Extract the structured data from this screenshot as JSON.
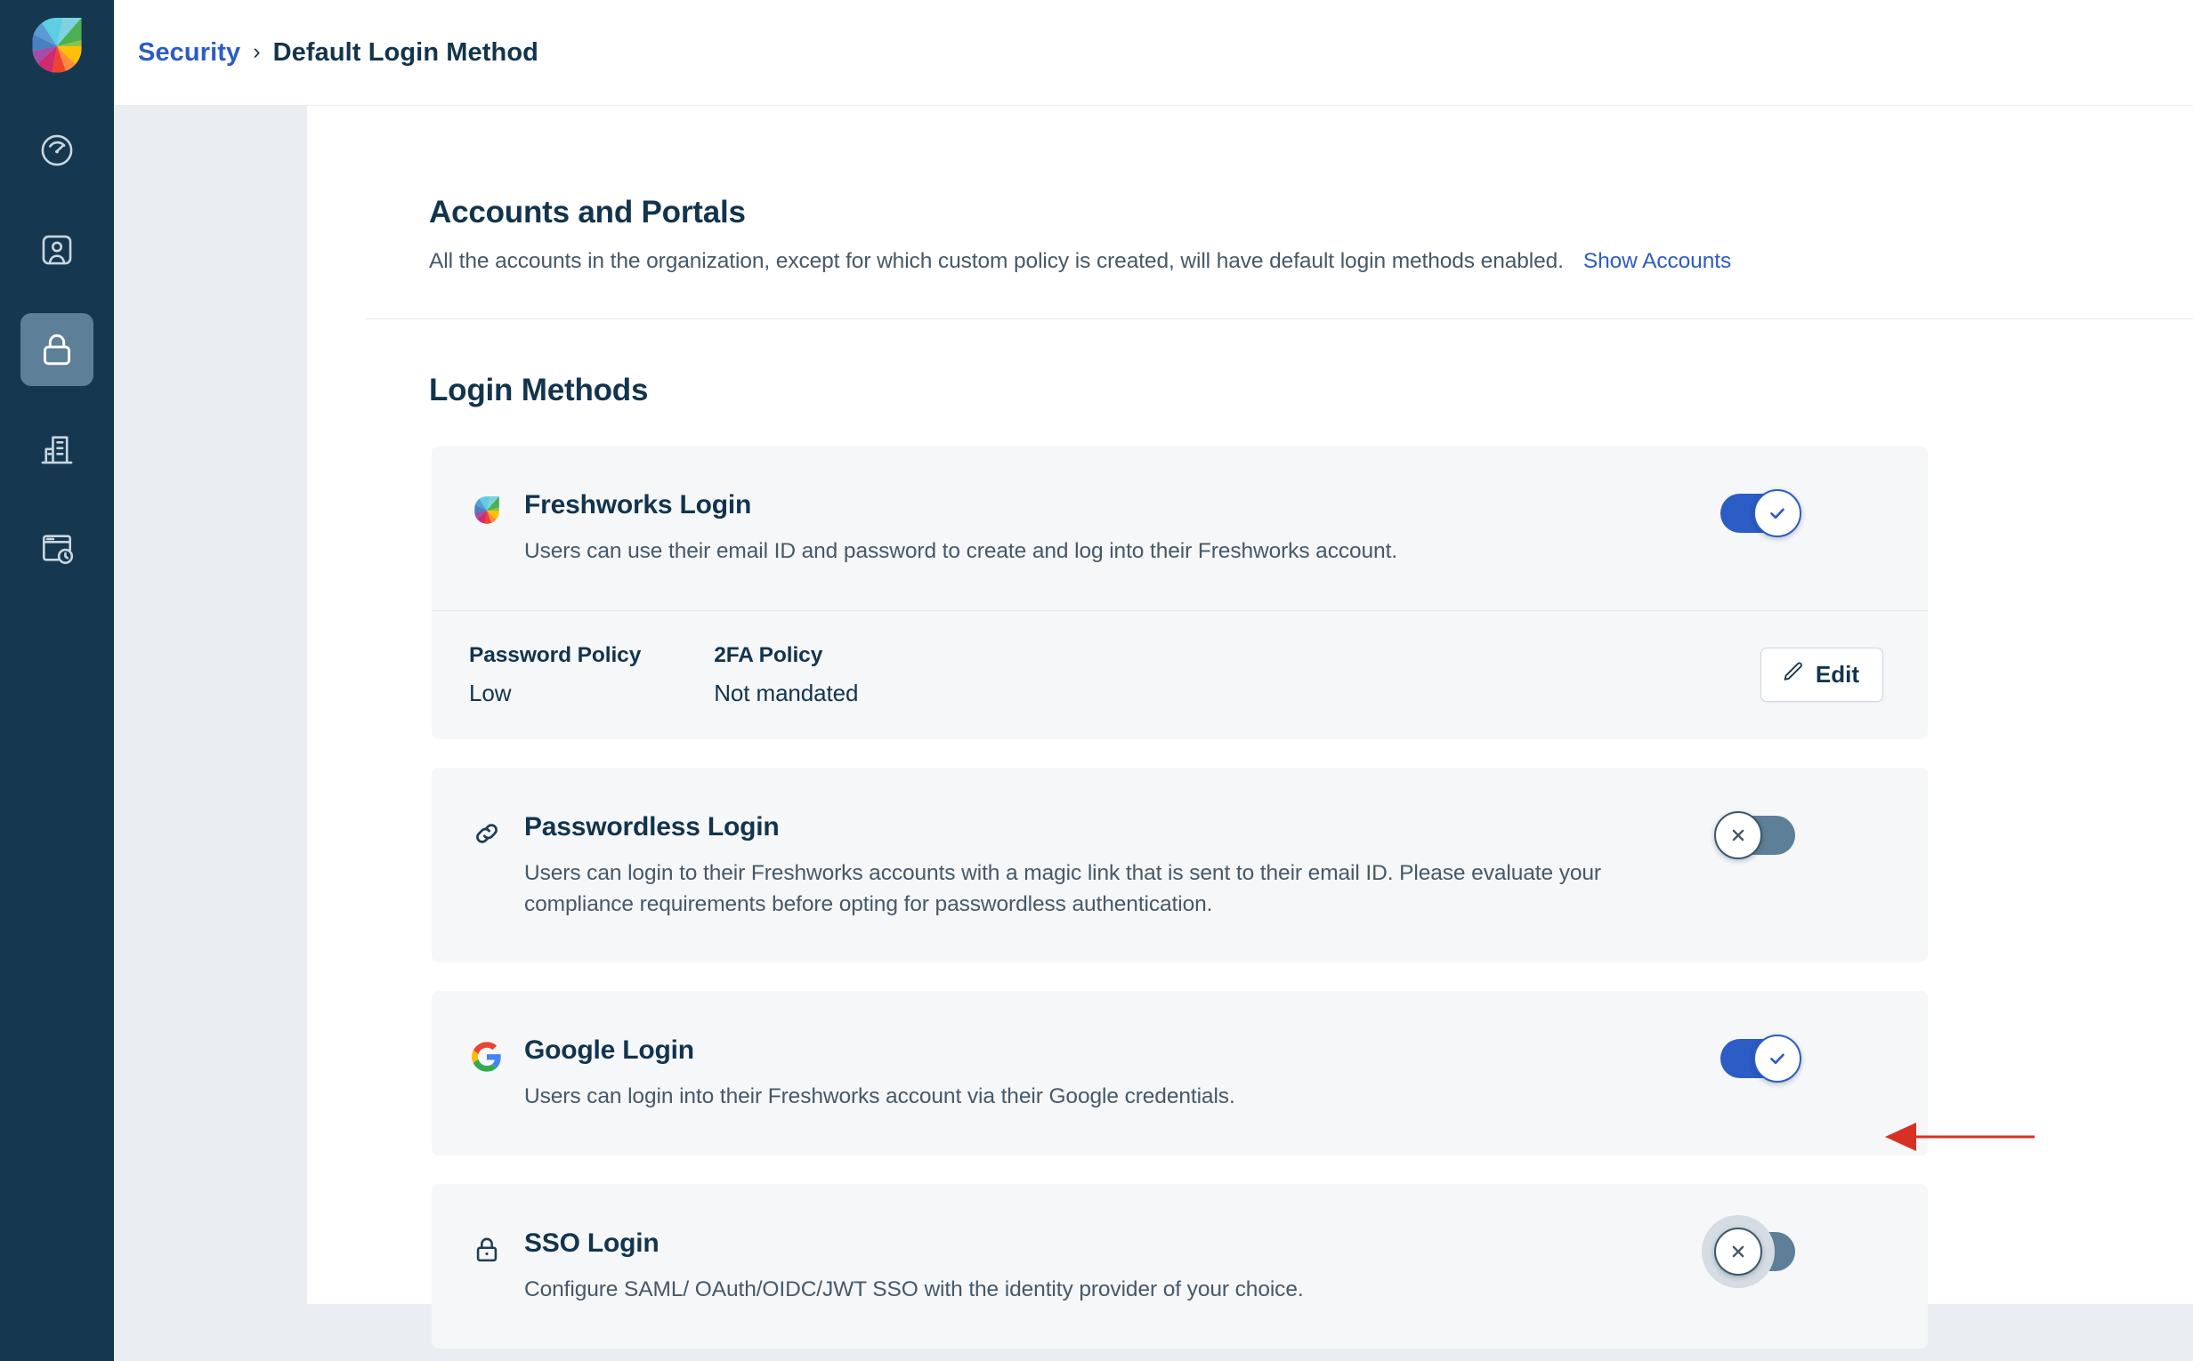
{
  "brand": {
    "logo_icon": "freshworks-logo",
    "accent_blue": "#2c5cc5",
    "rail_bg": "#15374f"
  },
  "sidebar": {
    "items": [
      {
        "icon": "dashboard-gauge-icon",
        "name": "dashboard",
        "active": false
      },
      {
        "icon": "user-profile-icon",
        "name": "users",
        "active": false
      },
      {
        "icon": "lock-icon",
        "name": "security",
        "active": true
      },
      {
        "icon": "building-icon",
        "name": "organization",
        "active": false
      },
      {
        "icon": "browser-clock-icon",
        "name": "audit-logs",
        "active": false
      }
    ]
  },
  "header": {
    "breadcrumb_root": "Security",
    "breadcrumb_separator": "›",
    "breadcrumb_current": "Default Login Method"
  },
  "accounts_section": {
    "title": "Accounts and Portals",
    "description": "All the accounts in the organization, except for which custom policy is created, will have default login methods enabled.",
    "link_label": "Show Accounts"
  },
  "login_methods": {
    "heading": "Login Methods",
    "items": [
      {
        "icon": "freshworks-logo-icon",
        "name": "Freshworks Login",
        "description": "Users can use their email ID and password to create and log into their Freshworks account.",
        "toggle_state": "on",
        "toggle_glyph": "check"
      },
      {
        "icon": "link-chain-icon",
        "name": "Passwordless Login",
        "description": "Users can login to their Freshworks accounts with a magic link that is sent to their email ID. Please evaluate your compliance requirements before opting for passwordless authentication.",
        "toggle_state": "off",
        "toggle_glyph": "cross"
      },
      {
        "icon": "google-g-icon",
        "name": "Google Login",
        "description": "Users can login into their Freshworks account via their Google credentials.",
        "toggle_state": "on",
        "toggle_glyph": "check"
      },
      {
        "icon": "padlock-icon",
        "name": "SSO Login",
        "description": "Configure SAML/ OAuth/OIDC/JWT SSO with the identity provider of your choice.",
        "toggle_state": "off",
        "toggle_glyph": "cross",
        "focused": true
      }
    ]
  },
  "policy_row": {
    "password_policy_label": "Password Policy",
    "password_policy_value": "Low",
    "twofa_policy_label": "2FA Policy",
    "twofa_policy_value": "Not mandated",
    "edit_label": "Edit",
    "edit_icon": "pencil-icon"
  },
  "annotation": {
    "arrow_color": "#d93025",
    "points_to": "sso-login-toggle"
  }
}
